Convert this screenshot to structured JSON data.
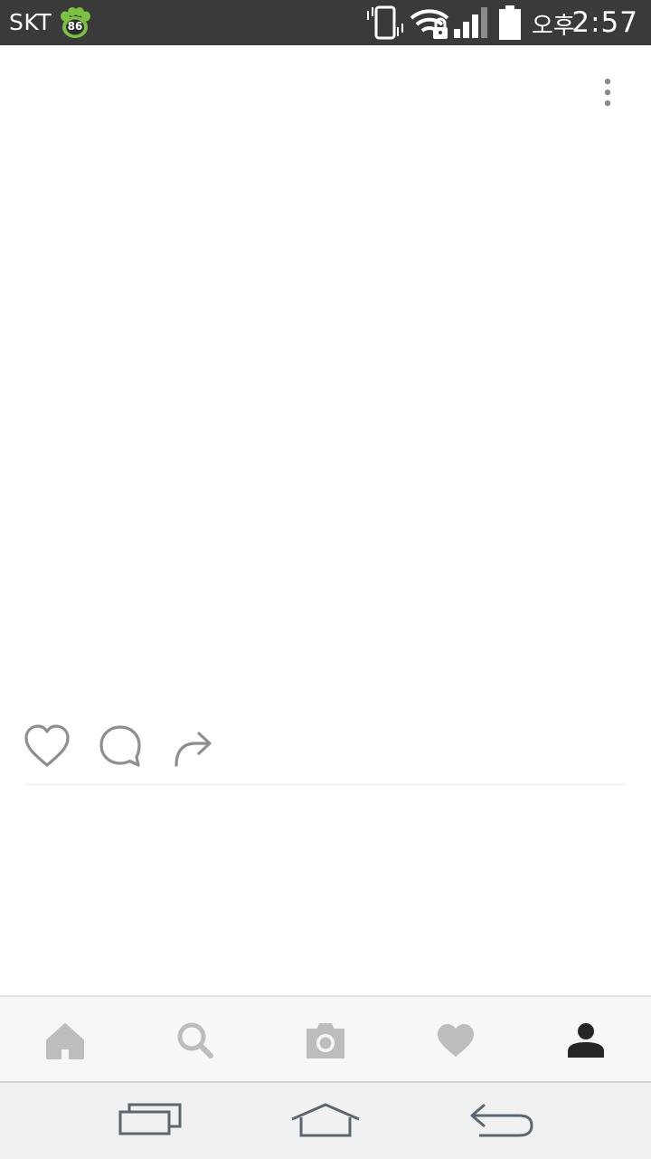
{
  "status_bar": {
    "carrier": "SKT",
    "badge_number": "86",
    "ampm": "오후",
    "time": "2:57",
    "icons": [
      "vibrate-icon",
      "wifi-lock-icon",
      "signal-icon",
      "battery-icon"
    ]
  },
  "post": {
    "more_icon": "more-vertical-icon",
    "actions": [
      "heart-icon",
      "comment-icon",
      "share-icon"
    ]
  },
  "tab_bar": {
    "tabs": [
      "home-icon",
      "search-icon",
      "camera-icon",
      "heart-icon",
      "profile-icon"
    ],
    "active_tab": "profile",
    "colors": {
      "inactive": "#bdbdbd",
      "active": "#262626"
    }
  },
  "nav_bar": {
    "buttons": [
      "recent-apps-icon",
      "home-nav-icon",
      "back-icon"
    ],
    "color": "#5a6670"
  }
}
